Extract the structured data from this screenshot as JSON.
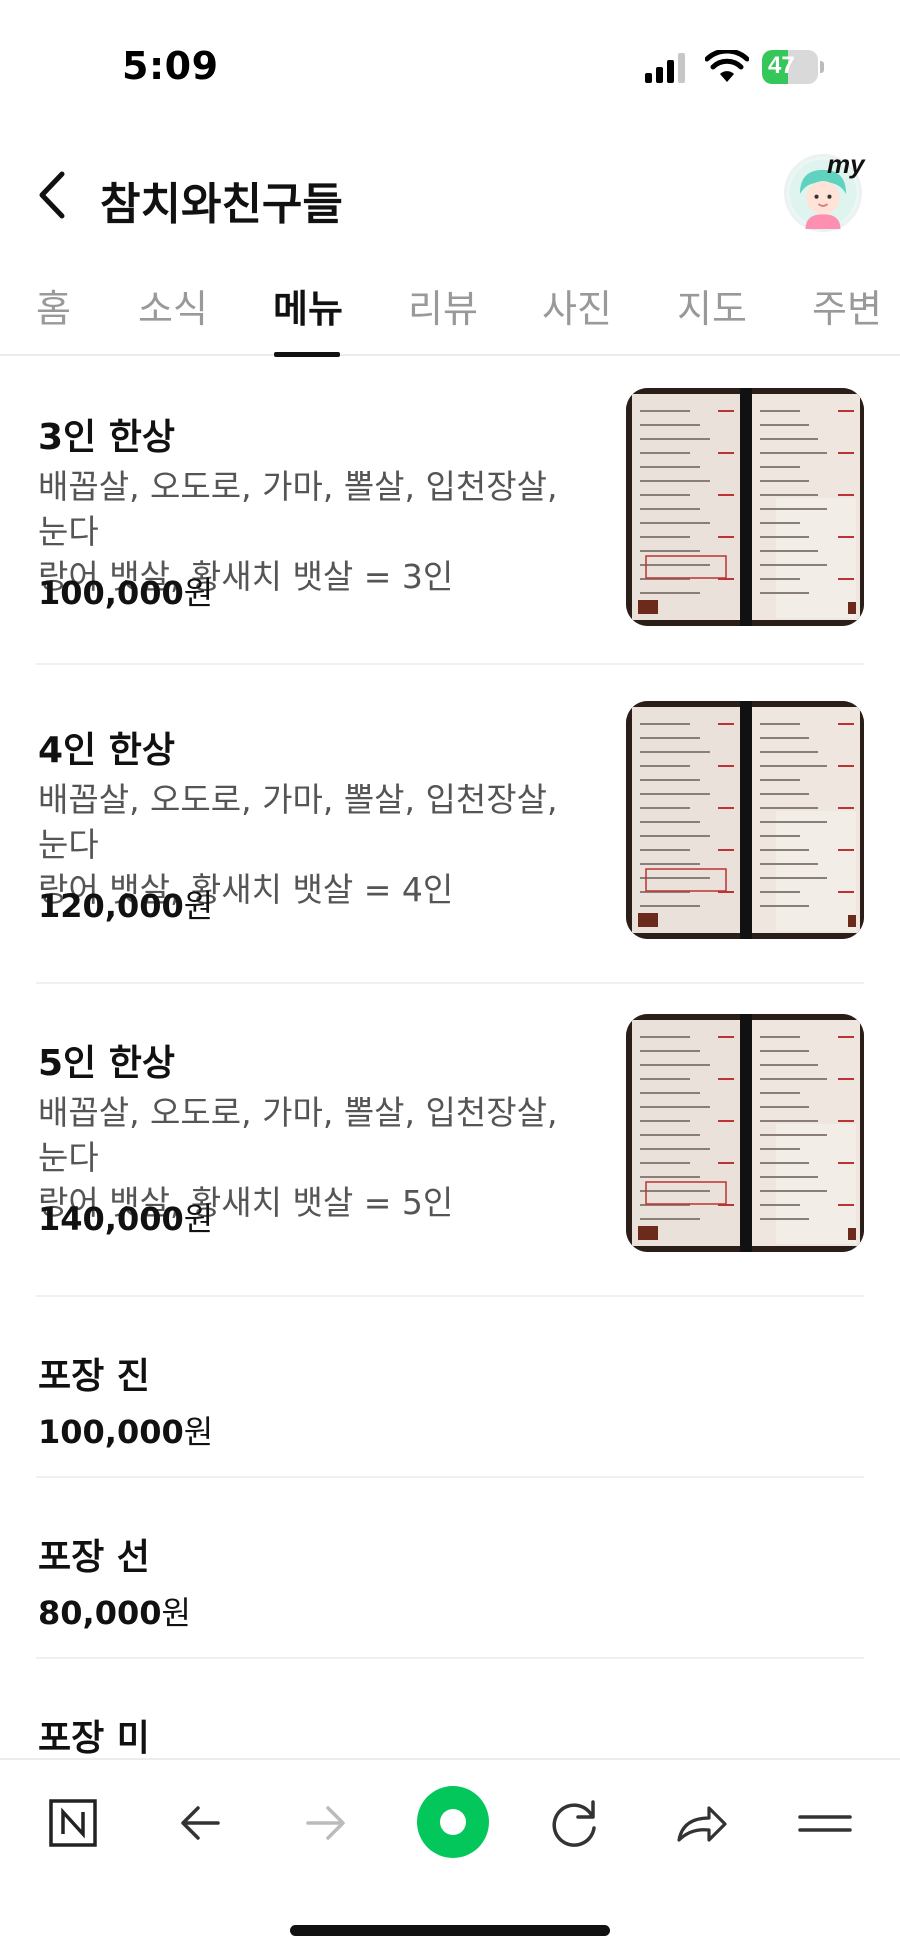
{
  "status": {
    "time": "5:09",
    "battery": "47",
    "battery_level": 0.47
  },
  "header": {
    "title": "참치와친구들",
    "avatar_badge": "my"
  },
  "tabs": [
    {
      "label": "홈"
    },
    {
      "label": "소식"
    },
    {
      "label": "메뉴",
      "active": true
    },
    {
      "label": "리뷰"
    },
    {
      "label": "사진"
    },
    {
      "label": "지도"
    },
    {
      "label": "주변"
    }
  ],
  "menu": [
    {
      "name": "3인 한상",
      "desc_line1": "배꼽살, 오도로, 가마, 뽈살, 입천장살, 눈다",
      "desc_line2": "랑어 뱃살, 황새치 뱃살 = 3인",
      "price": "100,000",
      "currency": "원"
    },
    {
      "name": "4인 한상",
      "desc_line1": "배꼽살, 오도로, 가마, 뽈살, 입천장살, 눈다",
      "desc_line2": "랑어 뱃살, 황새치 뱃살 = 4인",
      "price": "120,000",
      "currency": "원"
    },
    {
      "name": "5인 한상",
      "desc_line1": "배꼽살, 오도로, 가마, 뽈살, 입천장살, 눈다",
      "desc_line2": "랑어 뱃살, 황새치 뱃살 = 5인",
      "price": "140,000",
      "currency": "원"
    },
    {
      "name": "포장 진",
      "price": "100,000",
      "currency": "원"
    },
    {
      "name": "포장 선",
      "price": "80,000",
      "currency": "원"
    },
    {
      "name": "포장 미"
    }
  ],
  "colors": {
    "accent": "#03c75a",
    "text": "#111111",
    "muted": "#555555",
    "tab_inactive": "#999999"
  },
  "bottom_nav": [
    "naver-n-icon",
    "back-arrow-icon",
    "forward-arrow-icon",
    "green-dot-icon",
    "refresh-icon",
    "share-icon",
    "menu-icon"
  ]
}
